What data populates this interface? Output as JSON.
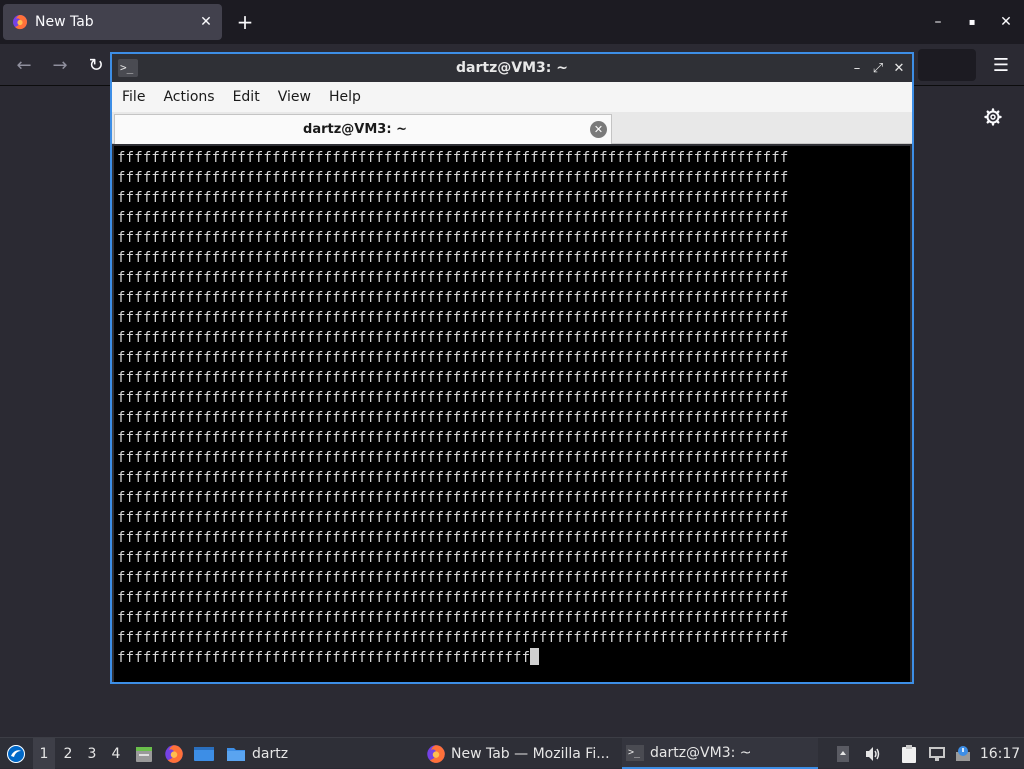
{
  "browser": {
    "tab_title": "New Tab",
    "tab_close_glyph": "✕",
    "new_tab_glyph": "+",
    "window_controls": {
      "minimize": "–",
      "maximize": "▪",
      "close": "✕"
    },
    "nav": {
      "back": "←",
      "forward": "→",
      "reload": "↻"
    },
    "menu_glyph": "☰"
  },
  "terminal": {
    "title": "dartz@VM3: ~",
    "icon_glyph": ">_",
    "window_controls": {
      "minimize": "–",
      "restore": "⤢",
      "close": "✕"
    },
    "menu": [
      "File",
      "Actions",
      "Edit",
      "View",
      "Help"
    ],
    "tab_label": "dartz@VM3: ~",
    "tab_close_glyph": "✕",
    "output": {
      "full_line_count": 25,
      "full_line": "ffffffffffffffffffffffffffffffffffffffffffffffffffffffffffffffffffffffffffffff",
      "last_line": "ffffffffffffffffffffffffffffffffffffffffffffffff"
    }
  },
  "taskbar": {
    "workspaces": [
      "1",
      "2",
      "3",
      "4"
    ],
    "active_workspace": "1",
    "folder_label": "dartz",
    "tasks": [
      {
        "label": "New Tab — Mozilla Fi..."
      },
      {
        "label": "dartz@VM3: ~"
      }
    ],
    "clock": "16:17"
  },
  "colors": {
    "accent": "#3d8ee6",
    "browser_bg": "#2b2a33",
    "terminal_bg": "#000000",
    "terminal_fg": "#d8d8d8"
  }
}
